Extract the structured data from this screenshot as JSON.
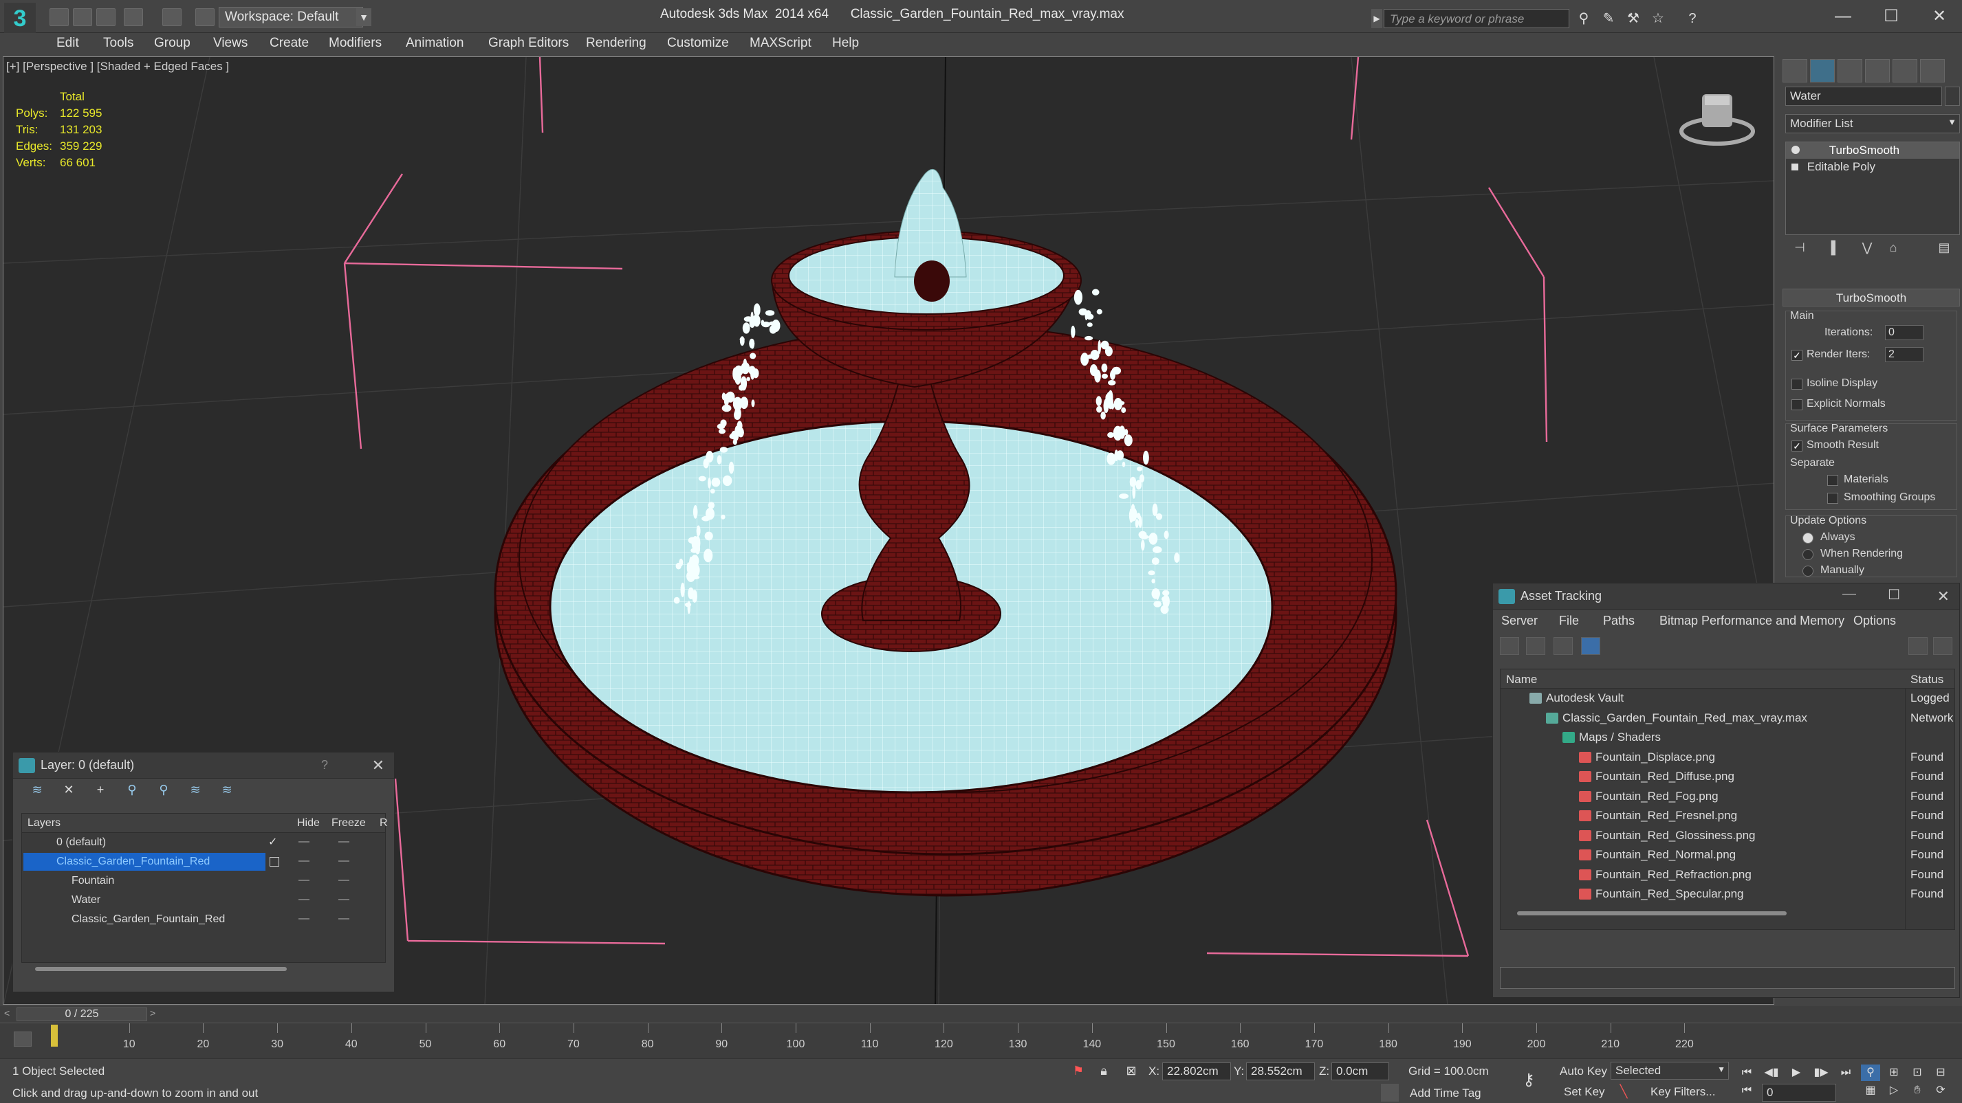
{
  "titlebar": {
    "workspace": "Workspace: Default",
    "title": "Autodesk 3ds Max  2014 x64      Classic_Garden_Fountain_Red_max_vray.max",
    "search_placeholder": "Type a keyword or phrase"
  },
  "menu": [
    "Edit",
    "Tools",
    "Group",
    "Views",
    "Create",
    "Modifiers",
    "Animation",
    "Graph Editors",
    "Rendering",
    "Customize",
    "MAXScript",
    "Help"
  ],
  "viewport": {
    "label": "[+] [Perspective ] [Shaded + Edged Faces ]",
    "stats_header": "Total",
    "stats": [
      {
        "k": "Polys:",
        "v": "122 595"
      },
      {
        "k": "Tris:",
        "v": "131 203"
      },
      {
        "k": "Edges:",
        "v": "359 229"
      },
      {
        "k": "Verts:",
        "v": "66 601"
      }
    ]
  },
  "command_panel": {
    "object_name": "Water",
    "modifier_list": "Modifier List",
    "stack": [
      "TurboSmooth",
      "Editable Poly"
    ],
    "rollout_title": "TurboSmooth",
    "main_label": "Main",
    "iterations_label": "Iterations:",
    "iterations_value": "0",
    "render_iters_label": "Render Iters:",
    "render_iters_value": "2",
    "isoline": "Isoline Display",
    "explicit_normals": "Explicit Normals",
    "surface_params": "Surface Parameters",
    "smooth_result": "Smooth Result",
    "separate": "Separate",
    "materials": "Materials",
    "smoothing_groups": "Smoothing Groups",
    "update_options": "Update Options",
    "always": "Always",
    "when_rendering": "When Rendering",
    "manually": "Manually"
  },
  "layer_panel": {
    "title": "Layer: 0 (default)",
    "help": "?",
    "col_layers": "Layers",
    "col_hide": "Hide",
    "col_freeze": "Freeze",
    "col_r": "R",
    "rows": [
      {
        "name": "0 (default)",
        "indent": 0
      },
      {
        "name": "Classic_Garden_Fountain_Red",
        "indent": 0
      },
      {
        "name": "Fountain",
        "indent": 1
      },
      {
        "name": "Water",
        "indent": 1
      },
      {
        "name": "Classic_Garden_Fountain_Red",
        "indent": 1
      }
    ]
  },
  "asset_panel": {
    "title": "Asset Tracking",
    "menu": [
      "Server",
      "File",
      "Paths",
      "Bitmap Performance and Memory",
      "Options"
    ],
    "col_name": "Name",
    "col_status": "Status",
    "rows": [
      {
        "name": "Autodesk Vault",
        "status": "Logged",
        "level": 1,
        "icon": "vault-icon"
      },
      {
        "name": "Classic_Garden_Fountain_Red_max_vray.max",
        "status": "Network",
        "level": 2,
        "icon": "max-file-icon"
      },
      {
        "name": "Maps / Shaders",
        "status": "",
        "level": 3,
        "icon": "maps-folder-icon"
      },
      {
        "name": "Fountain_Displace.png",
        "status": "Found",
        "level": 4,
        "icon": "png-icon"
      },
      {
        "name": "Fountain_Red_Diffuse.png",
        "status": "Found",
        "level": 4,
        "icon": "png-icon"
      },
      {
        "name": "Fountain_Red_Fog.png",
        "status": "Found",
        "level": 4,
        "icon": "png-icon"
      },
      {
        "name": "Fountain_Red_Fresnel.png",
        "status": "Found",
        "level": 4,
        "icon": "png-icon"
      },
      {
        "name": "Fountain_Red_Glossiness.png",
        "status": "Found",
        "level": 4,
        "icon": "png-icon"
      },
      {
        "name": "Fountain_Red_Normal.png",
        "status": "Found",
        "level": 4,
        "icon": "png-icon"
      },
      {
        "name": "Fountain_Red_Refraction.png",
        "status": "Found",
        "level": 4,
        "icon": "png-icon"
      },
      {
        "name": "Fountain_Red_Specular.png",
        "status": "Found",
        "level": 4,
        "icon": "png-icon"
      }
    ]
  },
  "timeline": {
    "frame_counter": "0 / 225",
    "ticks": [
      "10",
      "20",
      "30",
      "40",
      "50",
      "60",
      "70",
      "80",
      "90",
      "100",
      "110",
      "120",
      "130",
      "140",
      "150",
      "160",
      "170",
      "180",
      "190",
      "200",
      "210",
      "220"
    ]
  },
  "status": {
    "selection": "1 Object Selected",
    "prompt": "Click and drag up-and-down to zoom in and out",
    "x_label": "X:",
    "x_value": "22.802cm",
    "y_label": "Y:",
    "y_value": "28.552cm",
    "z_label": "Z:",
    "z_value": "0.0cm",
    "grid": "Grid = 100.0cm",
    "add_time_tag": "Add Time Tag",
    "auto_key": "Auto Key",
    "set_key": "Set Key",
    "selected": "Selected",
    "key_filters": "Key Filters...",
    "frame": "0"
  },
  "colors": {
    "accent": "#1a64c8",
    "stats": "#e8e82a",
    "fountain_stone": "#6b1414",
    "water": "#b9e6ea",
    "gizmo": "#e86a9a"
  }
}
